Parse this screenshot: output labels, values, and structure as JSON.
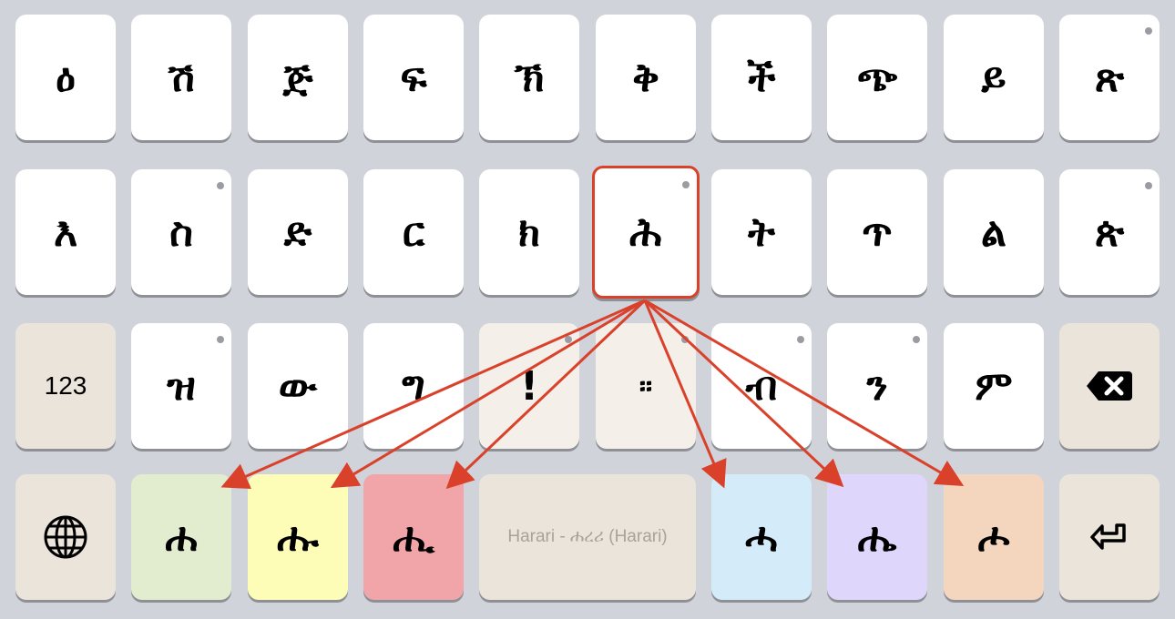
{
  "keyboard": {
    "row1": [
      {
        "label": "ዕ",
        "dot": false
      },
      {
        "label": "ሽ",
        "dot": false
      },
      {
        "label": "ጅ",
        "dot": false
      },
      {
        "label": "ፍ",
        "dot": false
      },
      {
        "label": "ኽ",
        "dot": false
      },
      {
        "label": "ቅ",
        "dot": false
      },
      {
        "label": "ች",
        "dot": false
      },
      {
        "label": "ጭ",
        "dot": false
      },
      {
        "label": "ይ",
        "dot": false
      },
      {
        "label": "ጽ",
        "dot": true
      }
    ],
    "row2": [
      {
        "label": "እ",
        "dot": false
      },
      {
        "label": "ስ",
        "dot": true
      },
      {
        "label": "ድ",
        "dot": false
      },
      {
        "label": "ር",
        "dot": false
      },
      {
        "label": "ክ",
        "dot": false
      },
      {
        "label": "ሕ",
        "dot": true,
        "highlight": true
      },
      {
        "label": "ት",
        "dot": false
      },
      {
        "label": "ጥ",
        "dot": false
      },
      {
        "label": "ል",
        "dot": false
      },
      {
        "label": "ጵ",
        "dot": true
      }
    ],
    "row3": [
      {
        "label": "123",
        "dot": false,
        "kind": "fn"
      },
      {
        "label": "ዝ",
        "dot": true
      },
      {
        "label": "ው",
        "dot": false
      },
      {
        "label": "ግ",
        "dot": false
      },
      {
        "label": "!",
        "dot": true,
        "kind": "punct"
      },
      {
        "label": "፡፡",
        "dot": true,
        "kind": "punct"
      },
      {
        "label": "ብ",
        "dot": true
      },
      {
        "label": "ን",
        "dot": true
      },
      {
        "label": "ም",
        "dot": false
      },
      {
        "label": "backspace",
        "icon": "backspace-icon",
        "kind": "fn"
      }
    ],
    "row4": {
      "globe_icon": "globe-icon",
      "space_label": "Harari - ሐረሪ (Harari)",
      "enter_icon": "enter-icon",
      "vowel_keys": [
        {
          "label": "ሐ",
          "color": "#e2edcf"
        },
        {
          "label": "ሑ",
          "color": "#fefdb8"
        },
        {
          "label": "ሒ",
          "color": "#f1a5a8"
        },
        {
          "label": "ሓ",
          "color": "#d4ecfa"
        },
        {
          "label": "ሔ",
          "color": "#dfd6fc"
        },
        {
          "label": "ሖ",
          "color": "#f4d6bf"
        }
      ]
    }
  },
  "colors": {
    "background": "#d0d3da",
    "key": "#ffffff",
    "function_key": "#ebe4da",
    "punct_key": "#f4efe9",
    "arrow": "#d9412b"
  }
}
